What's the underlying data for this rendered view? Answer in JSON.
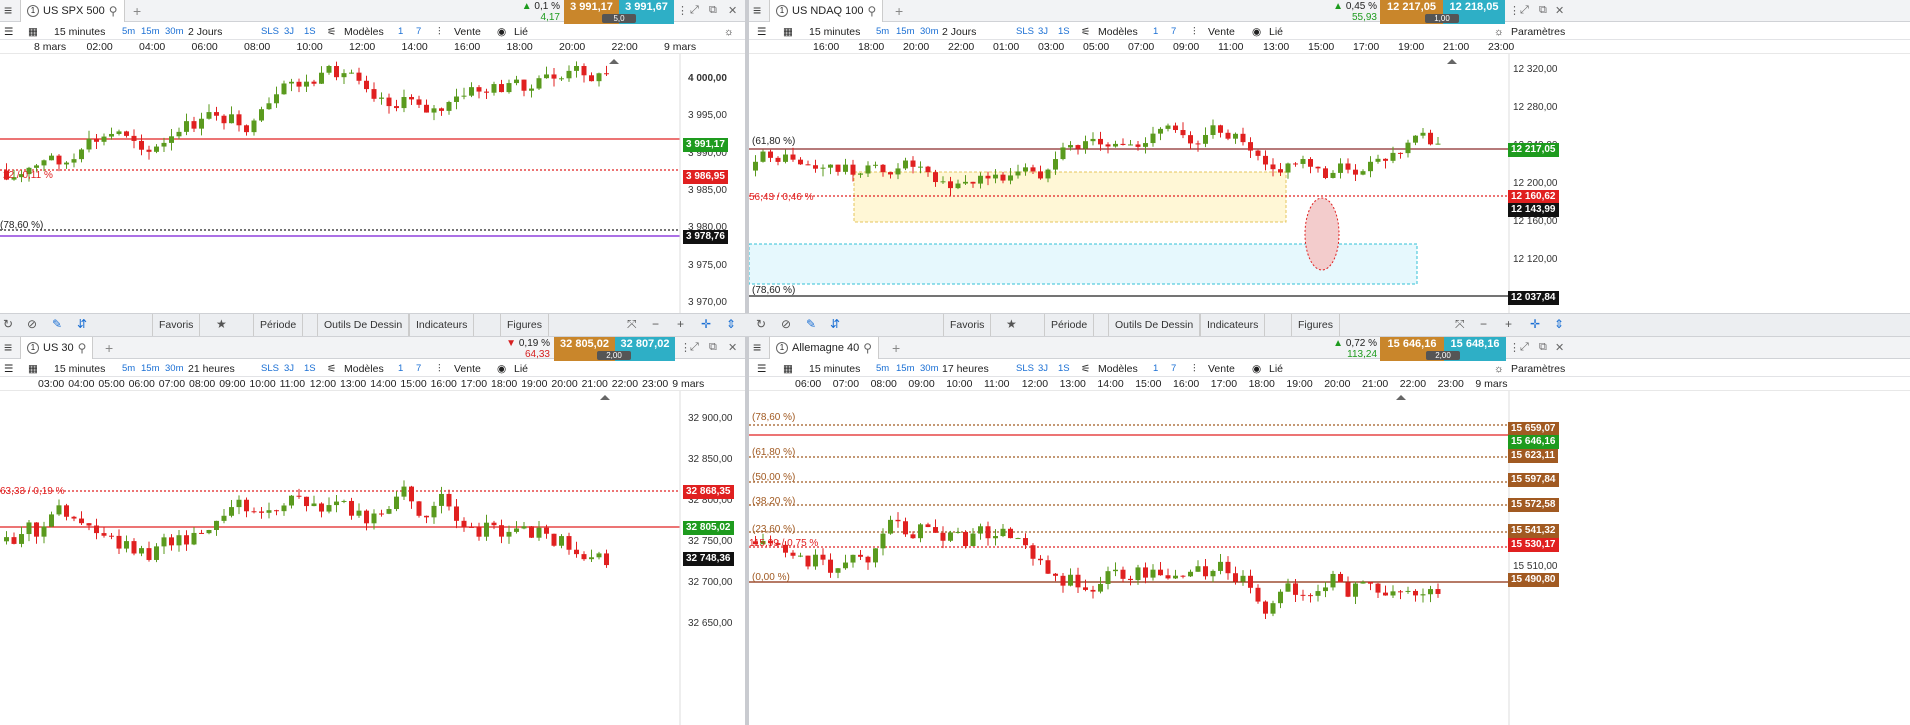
{
  "colors": {
    "up": "#5a9a1e",
    "down": "#e02020",
    "bid": "#c9862b",
    "ask": "#2eafc6",
    "green_tag": "#1e9b1e",
    "red_tag": "#e02020",
    "black_tag": "#111111",
    "purple": "#7a1cd6"
  },
  "toolbar_common": {
    "timeframe": "15 minutes",
    "q5m": "5m",
    "q15m": "15m",
    "q30m": "30m",
    "sls": "SLS",
    "d3": "3J",
    "s1": "1S",
    "models": "Modèles",
    "one": "1",
    "seven": "7",
    "sell": "Vente",
    "linked": "Lié",
    "settings": "Paramètres"
  },
  "bottom": {
    "favoris": "Favoris",
    "periode": "Période",
    "outils": "Outils De Dessin",
    "indicateurs": "Indicateurs",
    "figures": "Figures"
  },
  "panels": [
    {
      "tab_number": "1",
      "symbol": "US SPX 500",
      "change_pct": "0,1 %",
      "change_abs": "4,17",
      "change_dir": "up",
      "bid": "3 991,17",
      "ask": "3 991,67",
      "spread": "5,0",
      "period": "2 Jours",
      "time_labels": [
        "8 mars",
        "02:00",
        "04:00",
        "06:00",
        "08:00",
        "10:00",
        "12:00",
        "14:00",
        "16:00",
        "18:00",
        "20:00",
        "22:00",
        "9 mars"
      ],
      "price_labels": [
        "4 000,00",
        "3 995,00",
        "3 990,00",
        "3 985,00",
        "3 980,00",
        "3 975,00",
        "3 970,00"
      ],
      "tags": [
        {
          "text": "3 991,17",
          "kind": "green"
        },
        {
          "text": "3 986,95",
          "kind": "red"
        },
        {
          "text": "3 978,76",
          "kind": "black"
        }
      ],
      "fib": [
        "22 / 0,11 %",
        "(78,60 %)"
      ]
    },
    {
      "tab_number": "1",
      "symbol": "US NDAQ 100",
      "change_pct": "0,45 %",
      "change_abs": "55,93",
      "change_dir": "up",
      "bid": "12 217,05",
      "ask": "12 218,05",
      "spread": "1,00",
      "period": "2 Jours",
      "time_labels": [
        "16:00",
        "18:00",
        "20:00",
        "22:00",
        "01:00",
        "03:00",
        "05:00",
        "07:00",
        "09:00",
        "11:00",
        "13:00",
        "15:00",
        "17:00",
        "19:00",
        "21:00",
        "23:00"
      ],
      "price_labels": [
        "12 320,00",
        "12 280,00",
        "12 240,00",
        "12 200,00",
        "12 160,00",
        "12 120,00",
        "12 080,00"
      ],
      "tags": [
        {
          "text": "12 217,05",
          "kind": "green"
        },
        {
          "text": "12 160,62",
          "kind": "red"
        },
        {
          "text": "12 143,99",
          "kind": "black"
        },
        {
          "text": "12 037,84",
          "kind": "black"
        }
      ],
      "fib": [
        "(61,80 %)",
        "56,43 / 0,46 %",
        "(78,60 %)"
      ]
    },
    {
      "tab_number": "1",
      "symbol": "US 30",
      "change_pct": "0,19 %",
      "change_abs": "64,33",
      "change_dir": "down",
      "bid": "32 805,02",
      "ask": "32 807,02",
      "spread": "2,00",
      "period": "21 heures",
      "time_labels": [
        "03:00",
        "04:00",
        "05:00",
        "06:00",
        "07:00",
        "08:00",
        "09:00",
        "10:00",
        "11:00",
        "12:00",
        "13:00",
        "14:00",
        "15:00",
        "16:00",
        "17:00",
        "18:00",
        "19:00",
        "20:00",
        "21:00",
        "22:00",
        "23:00",
        "9 mars"
      ],
      "price_labels": [
        "32 900,00",
        "32 850,00",
        "32 800,00",
        "32 750,00",
        "32 700,00",
        "32 650,00"
      ],
      "tags": [
        {
          "text": "32 868,35",
          "kind": "red"
        },
        {
          "text": "32 805,02",
          "kind": "green"
        },
        {
          "text": "32 748,36",
          "kind": "black"
        }
      ],
      "fib": [
        "63,33 / 0,19 %"
      ]
    },
    {
      "tab_number": "1",
      "symbol": "Allemagne 40",
      "change_pct": "0,72 %",
      "change_abs": "113,24",
      "change_dir": "up",
      "bid": "15 646,16",
      "ask": "15 648,16",
      "spread": "2,00",
      "period": "17 heures",
      "time_labels": [
        "06:00",
        "07:00",
        "08:00",
        "09:00",
        "10:00",
        "11:00",
        "12:00",
        "13:00",
        "14:00",
        "15:00",
        "16:00",
        "17:00",
        "18:00",
        "19:00",
        "20:00",
        "21:00",
        "22:00",
        "23:00",
        "9 mars"
      ],
      "price_labels": [
        "15 510,00"
      ],
      "tags": [
        {
          "text": "15 659,07",
          "kind": "brown"
        },
        {
          "text": "15 646,16",
          "kind": "green"
        },
        {
          "text": "15 623,11",
          "kind": "brown"
        },
        {
          "text": "15 597,84",
          "kind": "brown"
        },
        {
          "text": "15 572,58",
          "kind": "brown"
        },
        {
          "text": "15 541,32",
          "kind": "brown"
        },
        {
          "text": "15 530,17",
          "kind": "red"
        },
        {
          "text": "15 490,80",
          "kind": "brown"
        }
      ],
      "fib": [
        "(78,60 %)",
        "(61,80 %)",
        "(50,00 %)",
        "(38,20 %)",
        "(23,60 %)",
        "115,99 / 0,75 %",
        "(0,00 %)"
      ]
    }
  ]
}
